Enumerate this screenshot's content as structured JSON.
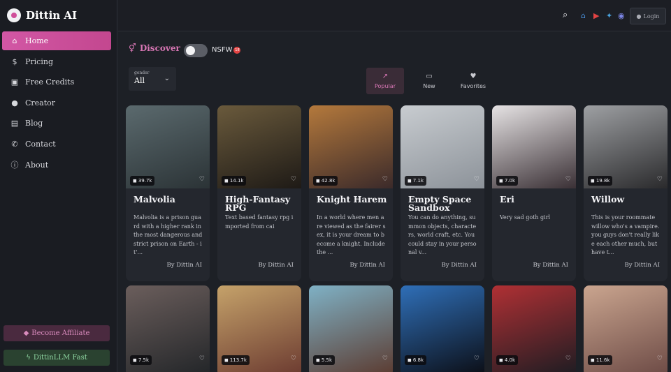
{
  "brand": {
    "name": "Dittin AI"
  },
  "nav": [
    {
      "label": "Home",
      "icon": "home-icon",
      "glyph": "⌂"
    },
    {
      "label": "Pricing",
      "icon": "pricing-icon",
      "glyph": "$"
    },
    {
      "label": "Free Credits",
      "icon": "gift-icon",
      "glyph": "▣"
    },
    {
      "label": "Creator",
      "icon": "user-icon",
      "glyph": "●"
    },
    {
      "label": "Blog",
      "icon": "blog-icon",
      "glyph": "▤"
    },
    {
      "label": "Contact",
      "icon": "contact-icon",
      "glyph": "✆"
    },
    {
      "label": "About",
      "icon": "info-icon",
      "glyph": "ⓘ"
    }
  ],
  "sidebar_buttons": {
    "affiliate": "Become Affiliate",
    "llm": "DittinLLM Fast"
  },
  "topbar": {
    "login": "Login"
  },
  "discover": {
    "label": "Discover",
    "nsfw": "NSFW",
    "nsfw_badge": "18"
  },
  "gender": {
    "label": "gender",
    "value": "All"
  },
  "tabs": [
    {
      "label": "Popular",
      "icon": "trending-icon",
      "glyph": "↗",
      "active": true
    },
    {
      "label": "New",
      "icon": "new-icon",
      "glyph": "▭",
      "active": false
    },
    {
      "label": "Favorites",
      "icon": "heart-icon",
      "glyph": "♥",
      "active": false
    }
  ],
  "cards": [
    {
      "stat": "39.7k",
      "title": "Malvolia",
      "desc": "Malvolia is a prison guard with a higher rank in the most dangerous and strict prison on Earth - it'...",
      "author": "By Dittin AI",
      "colors": [
        "#5b6a6e",
        "#2b3336"
      ]
    },
    {
      "stat": "14.1k",
      "title": "High-Fantasy RPG",
      "desc": "Text based fantasy rpg imported from cai",
      "author": "By Dittin AI",
      "colors": [
        "#6a5a3c",
        "#1e1a16"
      ]
    },
    {
      "stat": "42.8k",
      "title": "Knight Harem",
      "desc": "In a world where men are viewed as the fairer sex, it is your dream to become a knight. Include the ...",
      "author": "By Dittin AI",
      "colors": [
        "#b4793c",
        "#3b2a2a"
      ]
    },
    {
      "stat": "7.1k",
      "title": "Empty Space Sandbox",
      "desc": "You can do anything, summon objects, characters, world craft, etc. You could stay in your personal v...",
      "author": "By Dittin AI",
      "colors": [
        "#c8ccd0",
        "#8c9299"
      ]
    },
    {
      "stat": "7.0k",
      "title": "Eri",
      "desc": "Very sad goth girl",
      "author": "By Dittin AI",
      "colors": [
        "#e6e3e4",
        "#3a3035"
      ]
    },
    {
      "stat": "19.8k",
      "title": "Willow",
      "desc": "This is your roommate willow who's a vampire. you guys don't really like each other much, but have t...",
      "author": "By Dittin AI",
      "colors": [
        "#9ea0a3",
        "#2a2a2c"
      ]
    }
  ],
  "cards_row2": [
    {
      "stat": "7.5k",
      "colors": [
        "#6b5e5c",
        "#222528"
      ]
    },
    {
      "stat": "113.7k",
      "colors": [
        "#c5a26a",
        "#6b3a30"
      ]
    },
    {
      "stat": "5.5k",
      "colors": [
        "#7fb1c5",
        "#5b3a2f"
      ]
    },
    {
      "stat": "6.8k",
      "colors": [
        "#2f6fb8",
        "#0b0d14"
      ]
    },
    {
      "stat": "4.0k",
      "colors": [
        "#b03034",
        "#1c1c22"
      ]
    },
    {
      "stat": "11.6k",
      "colors": [
        "#caa58f",
        "#6c4a45"
      ]
    }
  ]
}
